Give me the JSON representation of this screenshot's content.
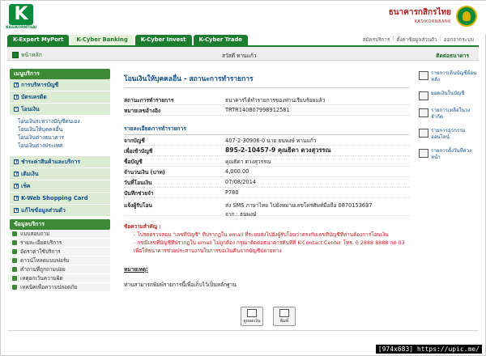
{
  "brand": {
    "logo_letter": "K",
    "logo_text": "KASIKORNTHAI",
    "bank_name_th": "ธนาคารกสิกรไทย",
    "bank_name_en": "KASIKORNBANK"
  },
  "tabs": [
    {
      "label": "K-Expert MyPort"
    },
    {
      "label": "K-Cyber Banking"
    },
    {
      "label": "K-Cyber Invest"
    },
    {
      "label": "K-Cyber Trade"
    }
  ],
  "toplinks": [
    "สมัครบริการ",
    "ตั้งค่าข้อมูลส่วนตัว",
    "ออกจากระบบ"
  ],
  "navbar": {
    "home": "หน้าหลัก",
    "greeting": "สวัสดี ทานแก้ว",
    "contact": "ติดต่อธนาคาร"
  },
  "sidebar": {
    "menu_title": "เมนูบริการ",
    "items": [
      {
        "label": "การบริหารบัญชี"
      },
      {
        "label": "บัตรเครดิต"
      },
      {
        "label": "โอนเงิน"
      }
    ],
    "transfer_sub": [
      "โอนเงินระหว่างบัญชีตนเอง",
      "โอนเงินให้บุคคลอื่น",
      "โอนเงินต่างธนาคาร",
      "โอนเงินต่างประเทศ"
    ],
    "items2": [
      {
        "label": "ชำระค่าสินค้าและบริการ"
      },
      {
        "label": "เติมเงิน"
      },
      {
        "label": "เช็ค"
      },
      {
        "label": "K-Web Shopping Card"
      },
      {
        "label": "แก้ไขข้อมูลส่วนตัว"
      }
    ],
    "info_title": "ข้อมูลบริการ",
    "info_items": [
      "แบบสอบถาม",
      "รายละเอียดบริการ",
      "อัตราค่าใช้บริการ",
      "ดาวน์โหลดแบบฟอร์ม",
      "คำถามที่ถูกถามบ่อย",
      "เหตุยกเว้นความผิด",
      "เทคนิคเพื่อความปลอดภัย"
    ]
  },
  "main": {
    "title": "โอนเงินให้บุคคลอื่น - สถานะการทำรายการ",
    "status_rows": [
      {
        "k": "สถานะการทำรายการ",
        "v": "ธนาคารได้ทำรายการของท่านเรียบร้อยแล้ว"
      },
      {
        "k": "หมายเลขอ้างอิง",
        "v": "TRTR140807998912581"
      }
    ],
    "detail_title": "รายละเอียดการทำรายการ",
    "detail_rows": [
      {
        "k": "จากบัญชี",
        "v": "407-2-30906-0 นาย ธนพงษ์ ทานแก้ว"
      },
      {
        "k": "เพื่อเข้าบัญชี",
        "v": "895-2-10457-9 คุณธิดา ดวงสุวรรณ"
      },
      {
        "k": "ชื่อบัญชี",
        "v": "คุณธิดา ดวงสุวรรณ"
      },
      {
        "k": "จำนวนเงิน (บาท)",
        "v": "4,000.00"
      },
      {
        "k": "วันที่โอนเงิน",
        "v": "07/08/2014"
      },
      {
        "k": "บันทึกช่วยจำ",
        "v": "P780"
      },
      {
        "k": "แจ้งผู้รับโอน",
        "v": "ส่ง SMS ภาษาไทย ไปยังหมายเลขโทรศัพท์มือถือ 0870153637",
        "v2": "จาก : ธนพงษ์"
      }
    ],
    "notes_title": "ข้อความสำคัญ :",
    "notes": [
      "- โปรดตรวจสอบ \"เลขที่บัญชี\" ที่ปรากฏใน email ที่ระบบส่งไปยังผู้รับโอนว่าตรงกับเลขที่บัญชีที่ท่านต้องการโอนเงิน",
      "- กรณีเลขที่บัญชีที่ปรากฏใน email ไม่ถูกต้อง กรุณาติดต่อธนาคารทันทีที่ K-Contact Center โทร. 0 2888 8888 กด 03 เพื่อให้ธนาคารช่วยประสานงานในการขอเงินคืนจากบัญชีปลายทาง"
    ],
    "remark_title": "หมายเหตุ:",
    "remark_text": "ท่านสามารถพิมพ์รายการนี้เพื่อเก็บไว้เป็นหลักฐาน",
    "buttons": [
      {
        "label": "ดูยอดเงิน"
      },
      {
        "label": "พิมพ์"
      }
    ]
  },
  "rail": [
    "รายการเดินบัญชีย้อนหลัง",
    "ยอดเงินในบัญชี",
    "รายการเหลือในวงจำกัด",
    "รายการธุรกรรมออนไลน์",
    "รายการตั้งวันที่ล่วงหน้า"
  ],
  "tag": "[974x683] https://upic.me/"
}
